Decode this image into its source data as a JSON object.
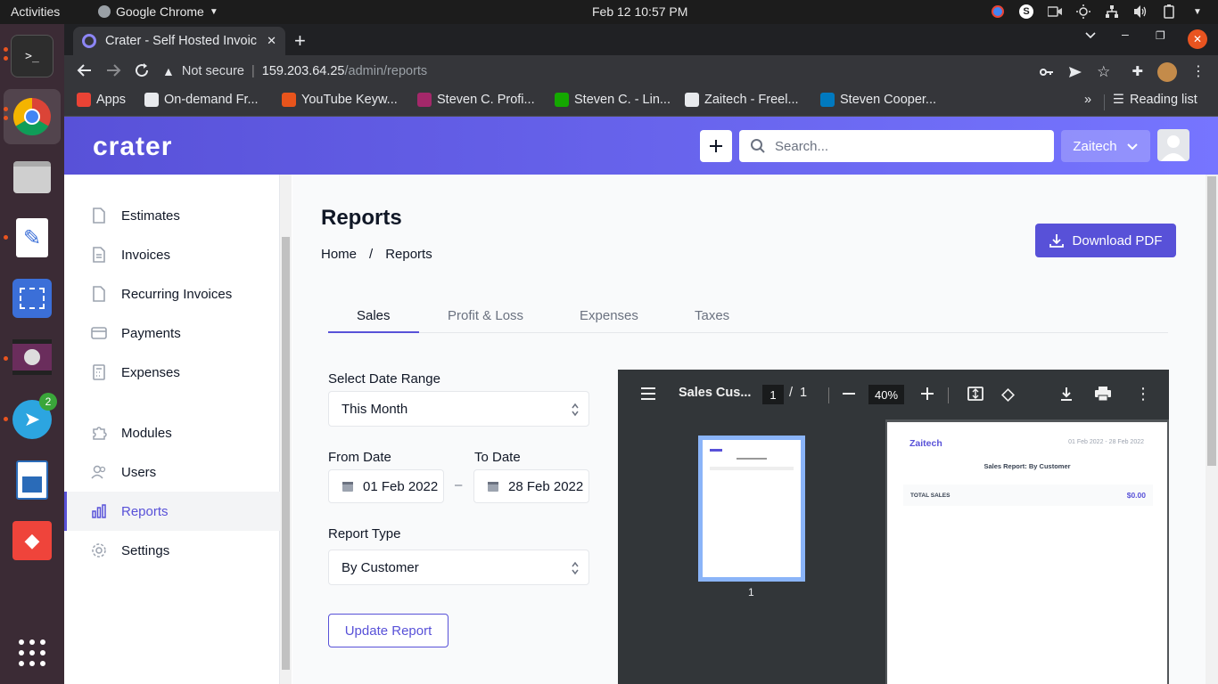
{
  "system": {
    "activities": "Activities",
    "app_name": "Google Chrome",
    "clock": "Feb 12  10:57 PM"
  },
  "browser": {
    "tab_title": "Crater - Self Hosted Invoic",
    "security": "Not secure",
    "url_host": "159.203.64.25",
    "url_path": "/admin/reports",
    "bookmarks": [
      {
        "label": "Apps",
        "icon": "apps-grid-icon",
        "color": "#ea4335"
      },
      {
        "label": "On-demand Fr...",
        "icon": "globe-icon",
        "color": "#e8eaed"
      },
      {
        "label": "YouTube Keyw...",
        "icon": "flame-icon",
        "color": "#e8541c"
      },
      {
        "label": "Steven C. Profi...",
        "icon": "yoast-icon",
        "color": "#a4286a"
      },
      {
        "label": "Steven C. - Lin...",
        "icon": "upwork-icon",
        "color": "#14a800"
      },
      {
        "label": "Zaitech - Freel...",
        "icon": "freelancer-icon",
        "color": "#e8eaed"
      },
      {
        "label": "Steven Cooper...",
        "icon": "trello-icon",
        "color": "#0079bf"
      }
    ],
    "reading_list": "Reading list"
  },
  "app": {
    "logo": "crater",
    "search_placeholder": "Search...",
    "company": "Zaitech"
  },
  "sidebar": {
    "items": [
      {
        "label": "Estimates",
        "icon": "document-icon"
      },
      {
        "label": "Invoices",
        "icon": "document-text-icon"
      },
      {
        "label": "Recurring Invoices",
        "icon": "document-icon"
      },
      {
        "label": "Payments",
        "icon": "credit-card-icon"
      },
      {
        "label": "Expenses",
        "icon": "calculator-icon"
      },
      {
        "label": "Modules",
        "icon": "puzzle-icon"
      },
      {
        "label": "Users",
        "icon": "users-icon"
      },
      {
        "label": "Reports",
        "icon": "chart-bar-icon"
      },
      {
        "label": "Settings",
        "icon": "cog-icon"
      }
    ]
  },
  "main": {
    "title": "Reports",
    "breadcrumb": [
      "Home",
      "/",
      "Reports"
    ],
    "download_label": "Download PDF",
    "tabs": [
      "Sales",
      "Profit & Loss",
      "Expenses",
      "Taxes"
    ],
    "date_range_label": "Select Date Range",
    "date_range_value": "This Month",
    "from_label": "From Date",
    "from_value": "01 Feb 2022",
    "to_label": "To Date",
    "to_value": "28 Feb 2022",
    "report_type_label": "Report Type",
    "report_type_value": "By Customer",
    "update_label": "Update Report"
  },
  "pdf": {
    "doc_title": "Sales Cus...",
    "page_current": "1",
    "page_sep": "/",
    "page_total": "1",
    "zoom": "40%",
    "thumb_number": "1",
    "company": "Zaitech",
    "date_range": "01 Feb 2022 - 28 Feb 2022",
    "report_title": "Sales Report: By Customer",
    "total_label": "TOTAL SALES",
    "total_value": "$0.00"
  },
  "colors": {
    "primary": "#5851d8",
    "header_gradient_end": "#7675ff"
  }
}
